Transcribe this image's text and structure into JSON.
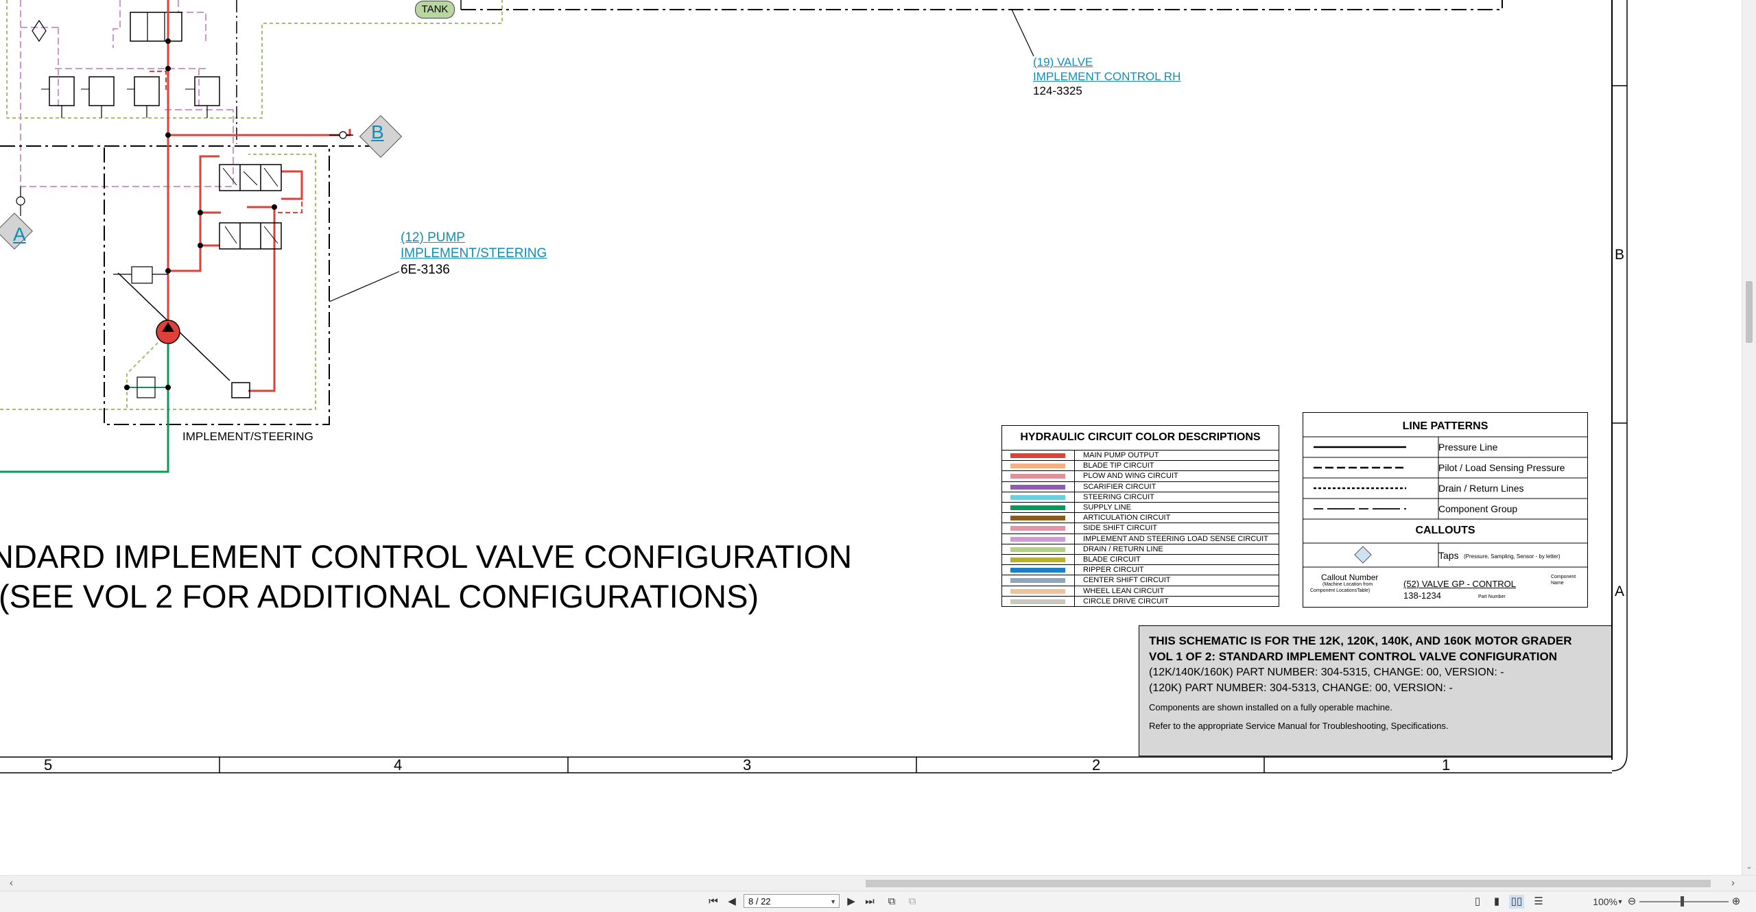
{
  "schematic": {
    "callouts": {
      "valve19": {
        "title": "(19) VALVE",
        "name": "IMPLEMENT CONTROL RH",
        "part": "124-3325"
      },
      "pump12": {
        "title": "(12) PUMP",
        "name": "IMPLEMENT/STEERING",
        "part": "6E-3136"
      }
    },
    "labels": {
      "tank": "TANK",
      "connector_a": "A",
      "connector_b": "B",
      "group_label": "IMPLEMENT/STEERING"
    },
    "main_title": {
      "line1": "NDARD IMPLEMENT CONTROL VALVE CONFIGURATION",
      "line2": "(SEE VOL 2 FOR ADDITIONAL CONFIGURATIONS)"
    },
    "border_rows": [
      "B",
      "A"
    ],
    "border_columns": [
      "5",
      "4",
      "3",
      "2",
      "1"
    ]
  },
  "color_legend": {
    "title": "HYDRAULIC CIRCUIT COLOR DESCRIPTIONS",
    "items": [
      {
        "label": "MAIN PUMP OUTPUT",
        "color": "#e0403a"
      },
      {
        "label": "BLADE TIP CIRCUIT",
        "color": "#f4b183"
      },
      {
        "label": "PLOW AND WING CIRCUIT",
        "color": "#ec8a95"
      },
      {
        "label": "SCARIFIER CIRCUIT",
        "color": "#8e5cb0"
      },
      {
        "label": "STEERING CIRCUIT",
        "color": "#6ccfe0"
      },
      {
        "label": "SUPPLY LINE",
        "color": "#0a9a58"
      },
      {
        "label": "ARTICULATION CIRCUIT",
        "color": "#8b5a1e"
      },
      {
        "label": "SIDE SHIFT CIRCUIT",
        "color": "#e98fa6"
      },
      {
        "label": "IMPLEMENT AND STEERING LOAD SENSE CIRCUIT",
        "color": "#cf9ad5"
      },
      {
        "label": "DRAIN / RETURN LINE",
        "color": "#b5cf8a"
      },
      {
        "label": "BLADE CIRCUIT",
        "color": "#b9b31c"
      },
      {
        "label": "RIPPER CIRCUIT",
        "color": "#1a7fc4"
      },
      {
        "label": "CENTER SHIFT CIRCUIT",
        "color": "#8fa6c2"
      },
      {
        "label": "WHEEL LEAN CIRCUIT",
        "color": "#eec39a"
      },
      {
        "label": "CIRCLE DRIVE CIRCUIT",
        "color": "#c9c9c2"
      }
    ]
  },
  "line_patterns": {
    "title": "LINE PATTERNS",
    "items": [
      "Pressure Line",
      "Pilot / Load Sensing Pressure",
      "Drain / Return Lines",
      "Component Group"
    ],
    "callouts_title": "CALLOUTS",
    "taps_label": "Taps",
    "taps_note": "(Pressure, Sampling, Sensor - by letter)",
    "callout_number": "Callout Number",
    "callout_number_note1": "(Machine Location from",
    "callout_number_note2": "Component LocationsTable)",
    "callout_example": "(52) VALVE GP - CONTROL",
    "callout_part": "138-1234",
    "part_number_note": "Part Number",
    "component_note1": "Component",
    "component_note2": "Name"
  },
  "info_box": {
    "line1": "THIS SCHEMATIC IS FOR THE 12K, 120K, 140K, AND 160K MOTOR GRADER",
    "line2": "VOL 1 OF 2: STANDARD IMPLEMENT CONTROL VALVE CONFIGURATION",
    "line3": "(12K/140K/160K) PART NUMBER: 304-5315, CHANGE: 00, VERSION: -",
    "line4": "(120K) PART NUMBER: 304-5313, CHANGE: 00, VERSION: -",
    "line5": "Components are shown installed on a fully operable machine.",
    "line6": "Refer to the appropriate Service Manual for Troubleshooting, Specifications."
  },
  "statusbar": {
    "page_indicator": "8 / 22",
    "zoom": "100%"
  }
}
